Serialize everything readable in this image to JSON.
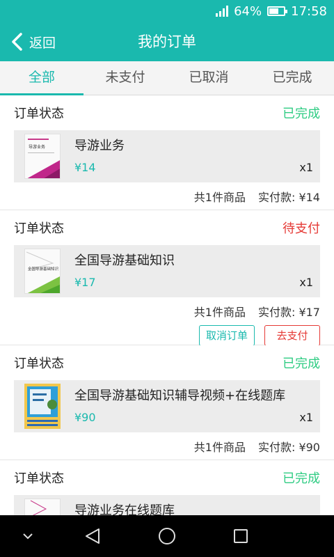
{
  "status_bar": {
    "battery": "64%",
    "time": "17:58",
    "battery_level": 0.64
  },
  "header": {
    "back_label": "返回",
    "title": "我的订单"
  },
  "tabs": [
    {
      "label": "全部",
      "active": true
    },
    {
      "label": "未支付",
      "active": false
    },
    {
      "label": "已取消",
      "active": false
    },
    {
      "label": "已完成",
      "active": false
    }
  ],
  "orders": [
    {
      "label": "订单状态",
      "status": "已完成",
      "status_type": "done",
      "product": {
        "name": "导游业务",
        "price": "¥14",
        "qty": "x1",
        "cover_title": "导游业务"
      },
      "count": "共1件商品",
      "paid": "实付款: ¥14"
    },
    {
      "label": "订单状态",
      "status": "待支付",
      "status_type": "pending",
      "product": {
        "name": "全国导游基础知识",
        "price": "¥17",
        "qty": "x1",
        "cover_title": "全国导游基础知识"
      },
      "count": "共1件商品",
      "paid": "实付款: ¥17",
      "actions": {
        "cancel": "取消订单",
        "pay": "去支付"
      }
    },
    {
      "label": "订单状态",
      "status": "已完成",
      "status_type": "done",
      "product": {
        "name": "全国导游基础知识辅导视频+在线题库",
        "price": "¥90",
        "qty": "x1"
      },
      "count": "共1件商品",
      "paid": "实付款: ¥90"
    },
    {
      "label": "订单状态",
      "status": "已完成",
      "status_type": "done",
      "product": {
        "name": "导游业务在线题库"
      }
    }
  ],
  "colors": {
    "accent": "#1ab9ae",
    "done": "#2fcc83",
    "pending": "#e53935"
  },
  "icons": {
    "back": "chevron-left-icon",
    "nav": [
      "chevron-down-icon",
      "triangle-back-icon",
      "circle-home-icon",
      "square-recents-icon"
    ]
  }
}
